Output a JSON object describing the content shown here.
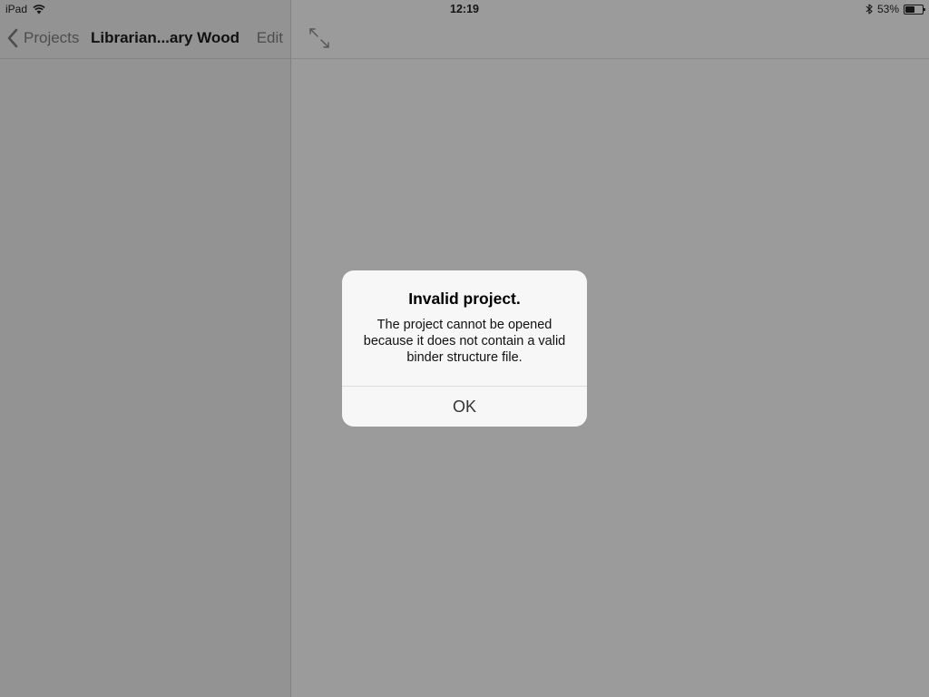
{
  "status_bar": {
    "device": "iPad",
    "time": "12:19",
    "battery_percent_label": "53%",
    "battery_level": 0.53,
    "icons": [
      "wifi-icon",
      "bluetooth-icon",
      "battery-icon"
    ]
  },
  "sidebar": {
    "back_label": "Projects",
    "title": "Librarian...ary Wood",
    "edit_label": "Edit"
  },
  "main": {
    "expand_icon": "expand-arrows-icon"
  },
  "alert": {
    "title": "Invalid project.",
    "message": "The project cannot be opened because it does not contain a valid binder structure file.",
    "ok_label": "OK"
  },
  "colors": {
    "dim_background": "#9b9b9b",
    "sidebar_background": "#939393",
    "alert_background": "#f7f7f7"
  }
}
